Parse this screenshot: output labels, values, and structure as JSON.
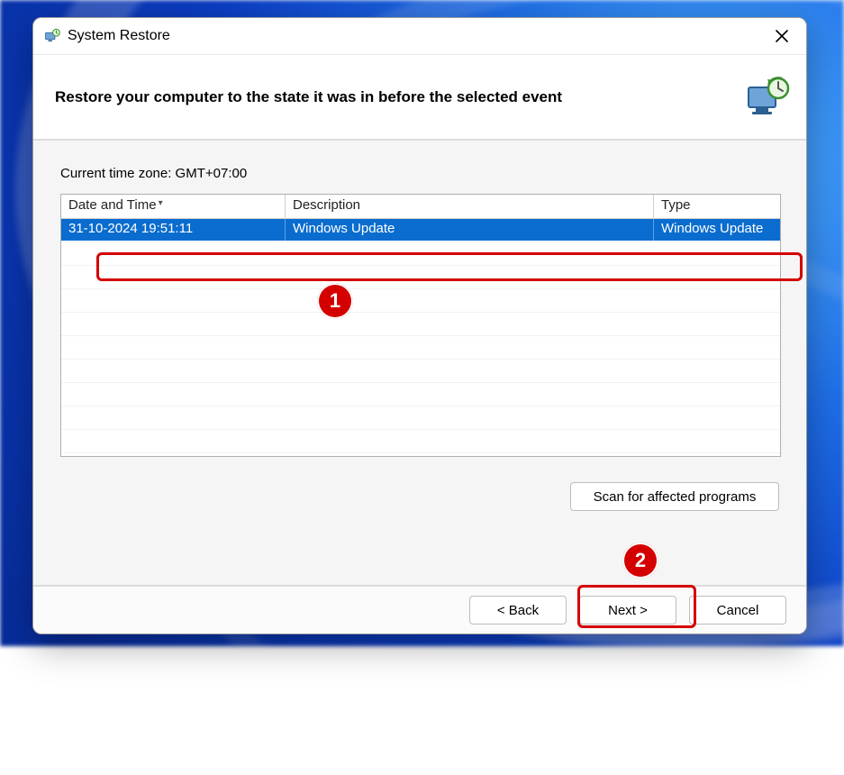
{
  "window": {
    "title": "System Restore"
  },
  "header": {
    "heading": "Restore your computer to the state it was in before the selected event"
  },
  "body": {
    "timezone_line": "Current time zone: GMT+07:00",
    "columns": {
      "date": "Date and Time",
      "desc": "Description",
      "type": "Type"
    },
    "rows": [
      {
        "date": "31-10-2024 19:51:11",
        "desc": "Windows Update",
        "type": "Windows Update",
        "selected": true
      }
    ],
    "scan_button": "Scan for affected programs"
  },
  "footer": {
    "back": "< Back",
    "next": "Next >",
    "cancel": "Cancel"
  },
  "annotations": {
    "badge1": "1",
    "badge2": "2"
  }
}
